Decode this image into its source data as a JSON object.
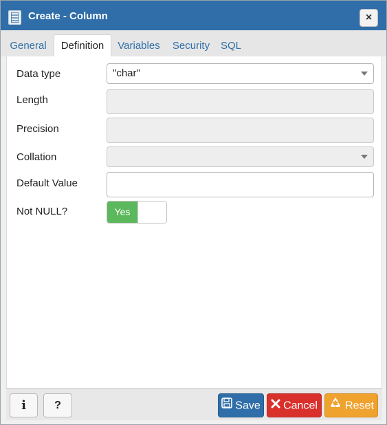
{
  "window": {
    "title": "Create - Column",
    "close_label": "×"
  },
  "tabs": [
    {
      "label": "General",
      "active": false
    },
    {
      "label": "Definition",
      "active": true
    },
    {
      "label": "Variables",
      "active": false
    },
    {
      "label": "Security",
      "active": false
    },
    {
      "label": "SQL",
      "active": false
    }
  ],
  "form": {
    "data_type": {
      "label": "Data type",
      "value": "\"char\""
    },
    "length": {
      "label": "Length",
      "value": ""
    },
    "precision": {
      "label": "Precision",
      "value": ""
    },
    "collation": {
      "label": "Collation",
      "value": ""
    },
    "default_value": {
      "label": "Default Value",
      "value": ""
    },
    "not_null": {
      "label": "Not NULL?",
      "toggle_label": "Yes",
      "on": true
    }
  },
  "footer": {
    "info_label": "i",
    "help_label": "?",
    "save_label": "Save",
    "cancel_label": "Cancel",
    "reset_label": "Reset"
  },
  "colors": {
    "titlebar": "#2f6ea8",
    "save": "#2f6ea8",
    "cancel": "#d9302c",
    "reset": "#f0a22e",
    "toggle_on": "#5cb85c"
  },
  "icons": {
    "title": "table-column-icon",
    "save": "floppy-disk-icon",
    "cancel": "x-icon",
    "reset": "recycle-icon"
  }
}
